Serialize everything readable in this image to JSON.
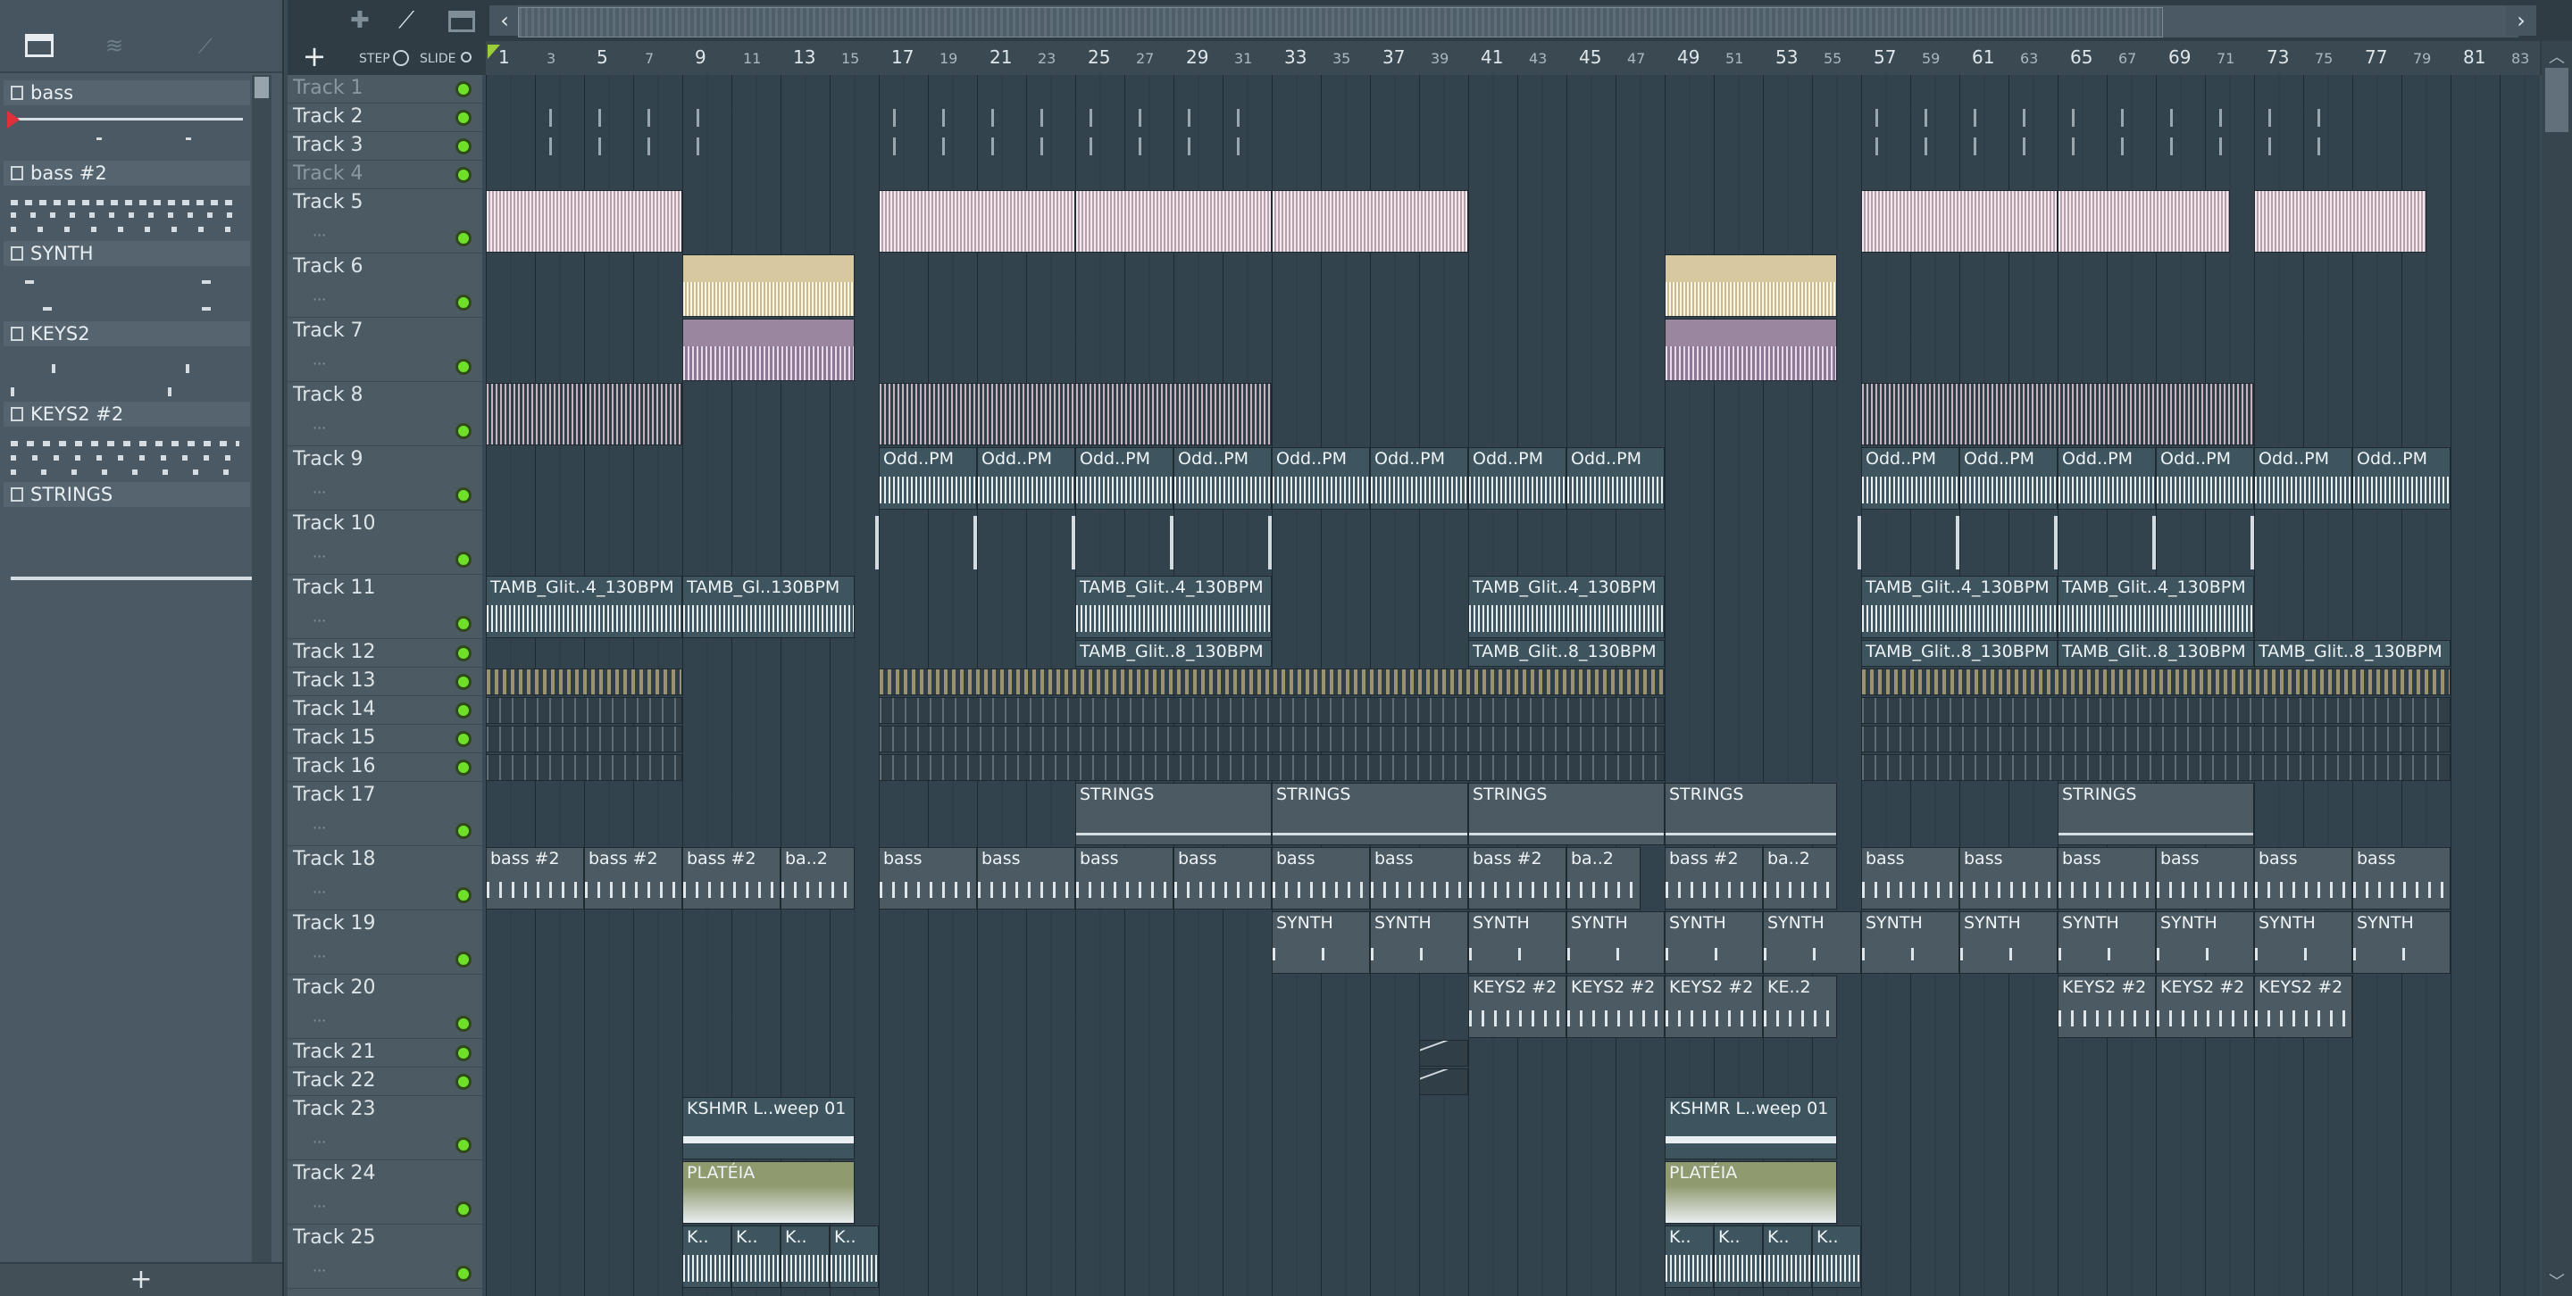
{
  "picker": {
    "items": [
      {
        "label": "bass"
      },
      {
        "label": "bass #2"
      },
      {
        "label": "SYNTH"
      },
      {
        "label": "KEYS2"
      },
      {
        "label": "KEYS2 #2"
      },
      {
        "label": "STRINGS"
      }
    ],
    "add_label": "+"
  },
  "toolbar": {
    "add_track_label": "+",
    "step_label": "STEP",
    "slide_label": "SLIDE"
  },
  "ruler": {
    "major": [
      "1",
      "5",
      "9",
      "13",
      "17",
      "21",
      "25",
      "29",
      "33",
      "37",
      "41",
      "45",
      "49",
      "53",
      "57",
      "61",
      "65",
      "69",
      "73",
      "77",
      "81"
    ],
    "minor": [
      "3",
      "7",
      "11",
      "15",
      "19",
      "23",
      "27",
      "31",
      "35",
      "39",
      "43",
      "47",
      "51",
      "55",
      "59",
      "63",
      "67",
      "71",
      "75",
      "79",
      "83"
    ]
  },
  "tracks": [
    {
      "name": "Track 1"
    },
    {
      "name": "Track 2"
    },
    {
      "name": "Track 3"
    },
    {
      "name": "Track 4"
    },
    {
      "name": "Track 5"
    },
    {
      "name": "Track 6"
    },
    {
      "name": "Track 7"
    },
    {
      "name": "Track 8"
    },
    {
      "name": "Track 9"
    },
    {
      "name": "Track 10"
    },
    {
      "name": "Track 11"
    },
    {
      "name": "Track 12"
    },
    {
      "name": "Track 13"
    },
    {
      "name": "Track 14"
    },
    {
      "name": "Track 15"
    },
    {
      "name": "Track 16"
    },
    {
      "name": "Track 17"
    },
    {
      "name": "Track 18"
    },
    {
      "name": "Track 19"
    },
    {
      "name": "Track 20"
    },
    {
      "name": "Track 21"
    },
    {
      "name": "Track 22"
    },
    {
      "name": "Track 23"
    },
    {
      "name": "Track 24"
    },
    {
      "name": "Track 25"
    }
  ],
  "clips": {
    "odd": "Odd..PM",
    "tamb4": "TAMB_Glit..4_130BPM",
    "tamb4b": "TAMB_Gl..130BPM",
    "tamb8": "TAMB_Glit..8_130BPM",
    "strings": "STRINGS",
    "bass": "bass",
    "bass2": "bass #2",
    "ba2": "ba..2",
    "synth": "SYNTH",
    "keys22": "KEYS2 #2",
    "ke2": "KE..2",
    "kshmr": "KSHMR L..weep 01",
    "plateia": "PLATÉIA",
    "k": "K.."
  },
  "colors": {
    "accent_led": "#6ee02a",
    "grid_bg": "#33434d"
  }
}
